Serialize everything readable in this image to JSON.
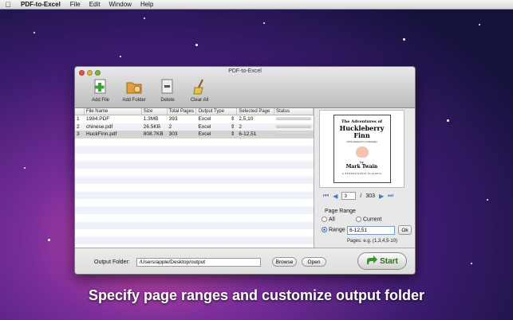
{
  "menubar": {
    "app_name": "PDF-to-Excel",
    "items": [
      "File",
      "Edit",
      "Window",
      "Help"
    ]
  },
  "window": {
    "title": "PDF-to-Excel"
  },
  "toolbar": {
    "items": [
      {
        "label": "Add File",
        "icon": "add-file-icon"
      },
      {
        "label": "Add Folder",
        "icon": "add-folder-icon"
      },
      {
        "label": "Delete",
        "icon": "delete-icon"
      },
      {
        "label": "Clear All",
        "icon": "broom-icon"
      }
    ]
  },
  "table": {
    "columns": [
      "",
      "File Name",
      "Size",
      "Total Pages",
      "Output Type",
      "Selected Page",
      "Status"
    ],
    "rows": [
      {
        "num": "1",
        "name": "1984.PDF",
        "size": "1.3MB",
        "pages": "393",
        "type": "Excel",
        "selected": "2,5,10",
        "status": ""
      },
      {
        "num": "2",
        "name": "chinese.pdf",
        "size": "26.5KB",
        "pages": "2",
        "type": "Excel",
        "selected": "2",
        "status": ""
      },
      {
        "num": "3",
        "name": "HuckFinn.pdf",
        "size": "808.7KB",
        "pages": "303",
        "type": "Excel",
        "selected": "6-12,51",
        "status": ""
      }
    ]
  },
  "preview": {
    "book_line1": "The Adventures of",
    "book_line2": "Huckleberry",
    "book_line3": "Finn",
    "book_sub": "(Tom Sawyer's Comrade)",
    "book_by": "by",
    "book_author": "Mark Twain",
    "book_foot": "A PENNSYLVANIA CLASSICS"
  },
  "pager": {
    "current_page": "3",
    "separator": "/",
    "total_pages": "303"
  },
  "page_range": {
    "title": "Page Range",
    "opt_all": "All",
    "opt_current": "Current",
    "opt_range": "Range",
    "range_value": "6-12,51",
    "ok_label": "Ok",
    "hint": "Pages: e.g. (1,3,4,5-10)",
    "selected": "Range"
  },
  "output": {
    "label": "Output Folder:",
    "path": "/Users/apple/Desktop/output",
    "browse_label": "Browse",
    "open_label": "Open",
    "start_label": "Start"
  },
  "caption": "Specify page ranges and customize output folder",
  "colors": {
    "accent_blue": "#4a78c6",
    "start_green": "#2d6a1d",
    "desktop_magenta": "#d24aa6"
  }
}
